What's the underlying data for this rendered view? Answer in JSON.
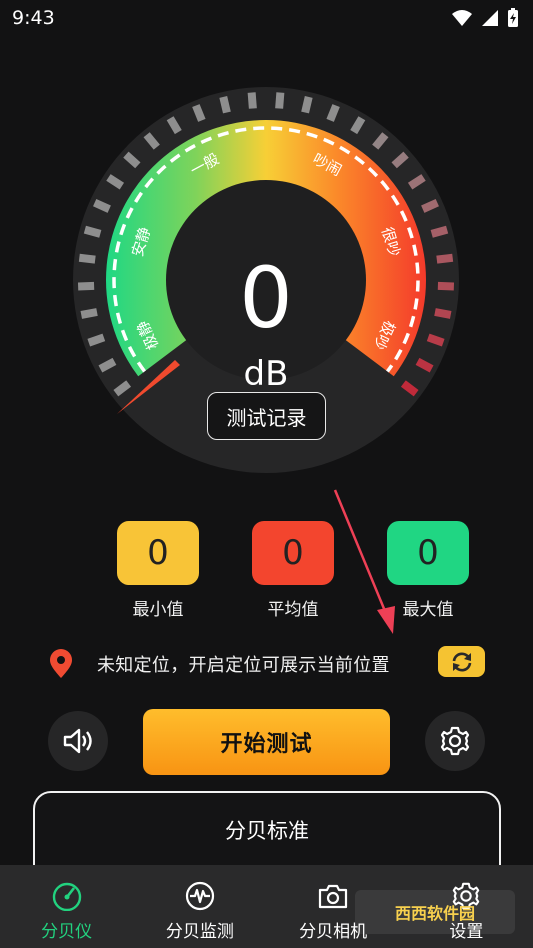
{
  "status": {
    "time": "9:43"
  },
  "gauge": {
    "value": "0",
    "unit": "dB",
    "zones": [
      "极静",
      "安静",
      "一般",
      "吵闹",
      "很吵",
      "极吵"
    ]
  },
  "record_button": "测试记录",
  "stats": [
    {
      "label": "最小值",
      "value": "0",
      "color": "#f8c437"
    },
    {
      "label": "平均值",
      "value": "0",
      "color": "#f3452e"
    },
    {
      "label": "最大值",
      "value": "0",
      "color": "#20d683"
    }
  ],
  "location": {
    "text": "未知定位，开启定位可展示当前位置",
    "pin_color": "#f04b32"
  },
  "start_button": "开始测试",
  "standard": {
    "title": "分贝标准"
  },
  "nav": [
    {
      "label": "分贝仪",
      "icon": "speedometer-icon",
      "active": true
    },
    {
      "label": "分贝监测",
      "icon": "waveform-icon",
      "active": false
    },
    {
      "label": "分贝相机",
      "icon": "camera-icon",
      "active": false
    },
    {
      "label": "设置",
      "icon": "gear-icon",
      "active": false
    }
  ],
  "watermark": "西西软件园"
}
